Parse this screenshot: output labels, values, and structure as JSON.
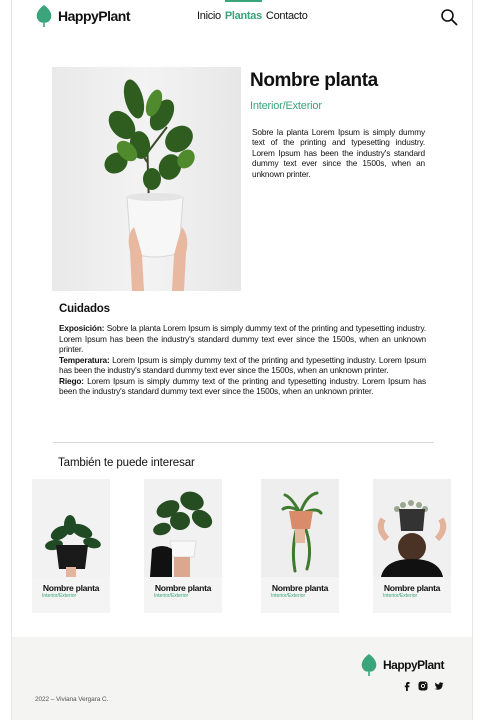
{
  "brand": {
    "name": "HappyPlant",
    "accent_color": "#3aa57a"
  },
  "nav": {
    "items": [
      {
        "label": "Inicio"
      },
      {
        "label": "Plantas",
        "active": true
      },
      {
        "label": "Contacto"
      }
    ]
  },
  "search": {
    "icon": "search-icon"
  },
  "product": {
    "name": "Nombre planta",
    "type": "Interior/Exterior",
    "description": "Sobre la planta Lorem Ipsum is simply dummy text of the printing and typesetting industry. Lorem Ipsum has been the industry's standard dummy text ever since the 1500s, when an unknown printer."
  },
  "care": {
    "title": "Cuidados",
    "items": [
      {
        "label": "Exposición:",
        "text": " Sobre la planta Lorem Ipsum is simply dummy text of the printing and typesetting industry. Lorem Ipsum has been the industry's standard dummy text ever since the 1500s, when an unknown printer."
      },
      {
        "label": "Temperatura:",
        "text": " Lorem Ipsum is simply dummy text of the printing and typesetting industry. Lorem Ipsum has been the industry's standard dummy text ever since the 1500s, when an unknown printer."
      },
      {
        "label": "Riego:",
        "text": " Lorem Ipsum is simply dummy text of the printing and typesetting industry. Lorem Ipsum has been the industry's standard dummy text ever since the 1500s, when an unknown printer."
      }
    ]
  },
  "related": {
    "title": "También te puede interesar",
    "cards": [
      {
        "name": "Nombre planta",
        "type": "Interior/Exterior"
      },
      {
        "name": "Nombre planta",
        "type": "Interior/Exterior"
      },
      {
        "name": "Nombre planta",
        "type": "Interior/Exterior"
      },
      {
        "name": "Nombre planta",
        "type": "Interior/Exterior"
      }
    ]
  },
  "footer": {
    "brand": "HappyPlant",
    "copyright": "2022 – Viviana Vergara C.",
    "social": [
      "facebook-icon",
      "instagram-icon",
      "twitter-icon"
    ]
  }
}
